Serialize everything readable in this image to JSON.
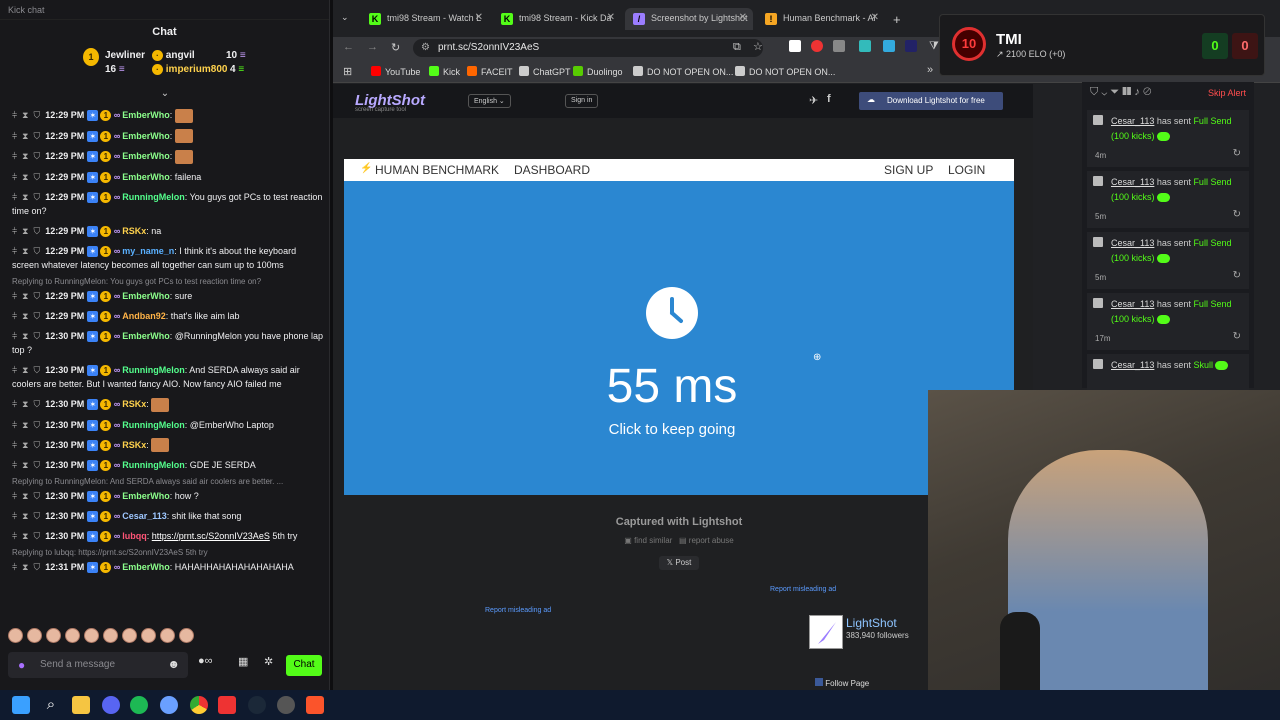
{
  "chat": {
    "window_title": "Kick chat",
    "title": "Chat",
    "leaders": [
      {
        "name": "Jewliner",
        "rank": "1",
        "amount": "16"
      },
      {
        "name": "angvil",
        "amount": "10"
      },
      {
        "name": "imperium800",
        "amount": "4"
      }
    ],
    "messages": [
      {
        "time": "12:29 PM",
        "user": "EmberWho",
        "cls": "u-ember",
        "text": "",
        "emote": true
      },
      {
        "time": "12:29 PM",
        "user": "EmberWho",
        "cls": "u-ember",
        "text": "",
        "emote": true
      },
      {
        "time": "12:29 PM",
        "user": "EmberWho",
        "cls": "u-ember",
        "text": "",
        "emote": true
      },
      {
        "time": "12:29 PM",
        "user": "EmberWho",
        "cls": "u-ember",
        "text": "failena"
      },
      {
        "time": "12:29 PM",
        "user": "RunningMelon",
        "cls": "u-running",
        "text": "You guys got PCs to test reaction time on?"
      },
      {
        "time": "12:29 PM",
        "user": "RSKx",
        "cls": "u-rskx",
        "text": "na"
      },
      {
        "time": "12:29 PM",
        "user": "my_name_n",
        "cls": "u-myname",
        "text": "I think it's about the keyboard screen whatever latency becomes all together can sum up to 100ms"
      },
      {
        "time": "12:29 PM",
        "user": "EmberWho",
        "cls": "u-ember",
        "text": "sure",
        "reply": "Replying to RunningMelon: You guys got PCs to test reaction time on?"
      },
      {
        "time": "12:29 PM",
        "user": "Andban92",
        "cls": "u-andban",
        "text": "that's like aim lab"
      },
      {
        "time": "12:30 PM",
        "user": "EmberWho",
        "cls": "u-ember",
        "text": "@RunningMelon you have phone lap top ?"
      },
      {
        "time": "12:30 PM",
        "user": "RunningMelon",
        "cls": "u-running",
        "text": "And SERDA always said air coolers are better. But I wanted fancy AIO. Now fancy AIO failed me"
      },
      {
        "time": "12:30 PM",
        "user": "RSKx",
        "cls": "u-rskx",
        "text": "",
        "emote": true
      },
      {
        "time": "12:30 PM",
        "user": "RunningMelon",
        "cls": "u-running",
        "text": "@EmberWho Laptop"
      },
      {
        "time": "12:30 PM",
        "user": "RSKx",
        "cls": "u-rskx",
        "text": "",
        "emote": true
      },
      {
        "time": "12:30 PM",
        "user": "RunningMelon",
        "cls": "u-running",
        "text": "GDE JE SERDA"
      },
      {
        "time": "12:30 PM",
        "user": "EmberWho",
        "cls": "u-ember",
        "text": "how ?",
        "reply": "Replying to RunningMelon: And SERDA always said air coolers are better. ..."
      },
      {
        "time": "12:30 PM",
        "user": "Cesar_113",
        "cls": "u-cesar",
        "text": "shit like that song"
      },
      {
        "time": "12:30 PM",
        "user": "lubqq",
        "cls": "u-lubqq",
        "text": "5th try",
        "link": "https://prnt.sc/S2onnIV23AeS"
      },
      {
        "time": "12:31 PM",
        "user": "EmberWho",
        "cls": "u-ember",
        "text": "HAHAHHAHAHAHAHAHAHA",
        "reply": "Replying to lubqq: https://prnt.sc/S2onnIV23AeS 5th try"
      }
    ],
    "input_placeholder": "Send a message",
    "send_label": "Chat"
  },
  "browser": {
    "tabs": [
      {
        "label": "tmi98 Stream - Watch L",
        "color": "#53fc18",
        "glyph": "K"
      },
      {
        "label": "tmi98 Stream - Kick Da",
        "color": "#53fc18",
        "glyph": "K"
      },
      {
        "label": "Screenshot by Lightshot",
        "color": "#9b7dff",
        "glyph": "/",
        "active": true
      },
      {
        "label": "Human Benchmark - Al",
        "color": "#f5a623",
        "glyph": "!"
      }
    ],
    "url": "prnt.sc/S2onnIV23AeS",
    "bookmarks": [
      "YouTube",
      "Kick",
      "FACEIT",
      "ChatGPT",
      "Duolingo",
      "DO NOT OPEN ON...",
      "DO NOT OPEN ON..."
    ]
  },
  "lightshot": {
    "logo": "LightShot",
    "logo_sub": "screen capture tool",
    "lang": "English",
    "signin": "Sign in",
    "download": "Download Lightshot for free",
    "captured": "Captured with Lightshot",
    "find_similar": "find similar",
    "report_abuse": "report abuse",
    "post": "Post",
    "report_ad": "Report misleading ad",
    "fb_name": "LightShot",
    "fb_followers": "383,940 followers",
    "fb_follow": "Follow Page"
  },
  "benchmark": {
    "nav_brand": "HUMAN BENCHMARK",
    "nav_dashboard": "DASHBOARD",
    "nav_signup": "SIGN UP",
    "nav_login": "LOGIN",
    "result": "55 ms",
    "cta": "Click to keep going",
    "bg_color": "#2b87d1"
  },
  "alerts": {
    "skip": "Skip Alert",
    "items": [
      {
        "user": "Cesar_113",
        "pre": "has sent",
        "amount": "Full Send (100 kicks)",
        "ago": "4m"
      },
      {
        "user": "Cesar_113",
        "pre": "has sent",
        "amount": "Full Send (100 kicks)",
        "ago": "5m"
      },
      {
        "user": "Cesar_113",
        "pre": "has sent",
        "amount": "Full Send (100 kicks)",
        "ago": "5m"
      },
      {
        "user": "Cesar_113",
        "pre": "has sent",
        "amount": "Full Send (100 kicks)",
        "ago": "17m"
      },
      {
        "user": "Cesar_113",
        "pre": "has sent",
        "amount": "Skull",
        "ago": ""
      }
    ]
  },
  "score": {
    "level": "10",
    "name": "TMI",
    "elo": "2100 ELO (+0)",
    "left": "0",
    "right": "0"
  }
}
